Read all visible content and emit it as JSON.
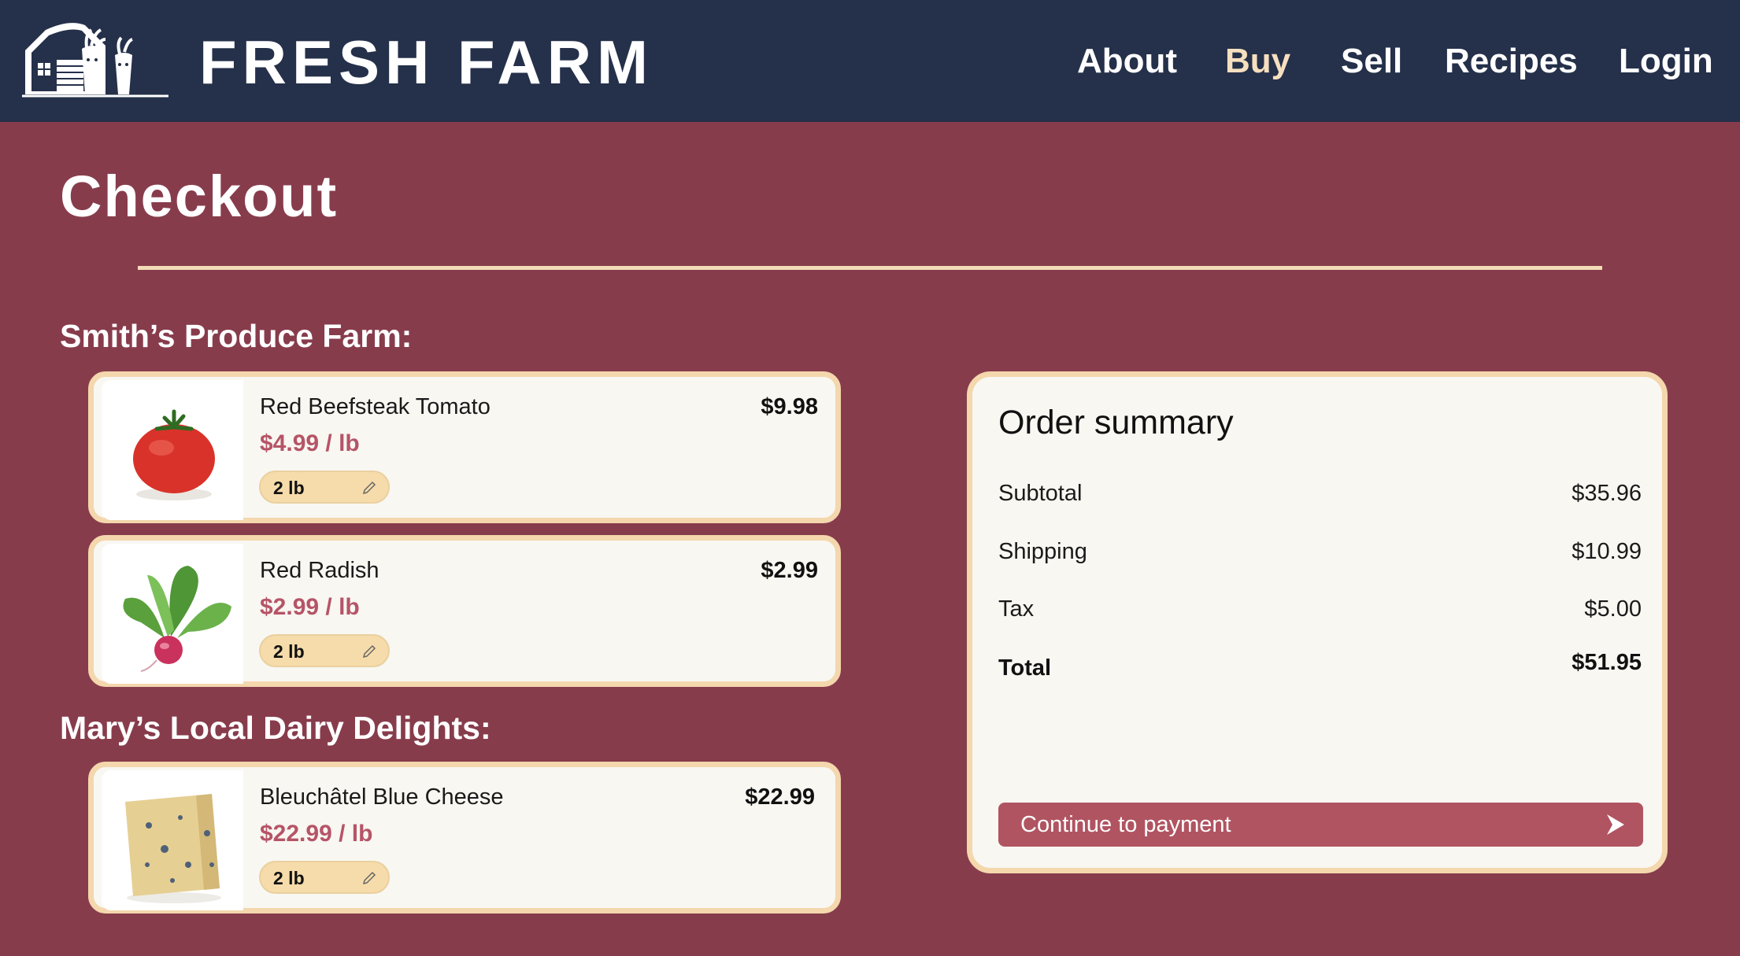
{
  "header": {
    "brand": "FRESH FARM",
    "nav": [
      "About",
      "Buy",
      "Sell",
      "Recipes",
      "Login"
    ],
    "active_nav": "Buy",
    "colors": {
      "background": "#25304a",
      "active": "#f6dfbf"
    }
  },
  "page": {
    "title": "Checkout",
    "background": "#873c4c",
    "accent": "#f4d7ad"
  },
  "farms": [
    {
      "heading": "Smith’s Produce Farm:",
      "items": [
        {
          "name": "Red Beefsteak Tomato",
          "unit_price": "$4.99 / lb",
          "total": "$9.98",
          "quantity": "2 lb",
          "image": "tomato-image"
        },
        {
          "name": "Red Radish",
          "unit_price": "$2.99 / lb",
          "total": "$2.99",
          "quantity": "2 lb",
          "image": "radish-image"
        }
      ]
    },
    {
      "heading": "Mary’s Local Dairy Delights:",
      "items": [
        {
          "name": "Bleuchâtel Blue Cheese",
          "unit_price": "$22.99 / lb",
          "total": "$22.99",
          "quantity": "2 lb",
          "image": "blue-cheese-image"
        }
      ]
    }
  ],
  "summary": {
    "title": "Order summary",
    "rows": [
      {
        "label": "Subtotal",
        "value": "$35.96"
      },
      {
        "label": "Shipping",
        "value": "$10.99"
      },
      {
        "label": "Tax",
        "value": "$5.00"
      },
      {
        "label": "Total",
        "value": "$51.95"
      }
    ],
    "button_label": "Continue to payment",
    "button_color": "#b05461"
  }
}
